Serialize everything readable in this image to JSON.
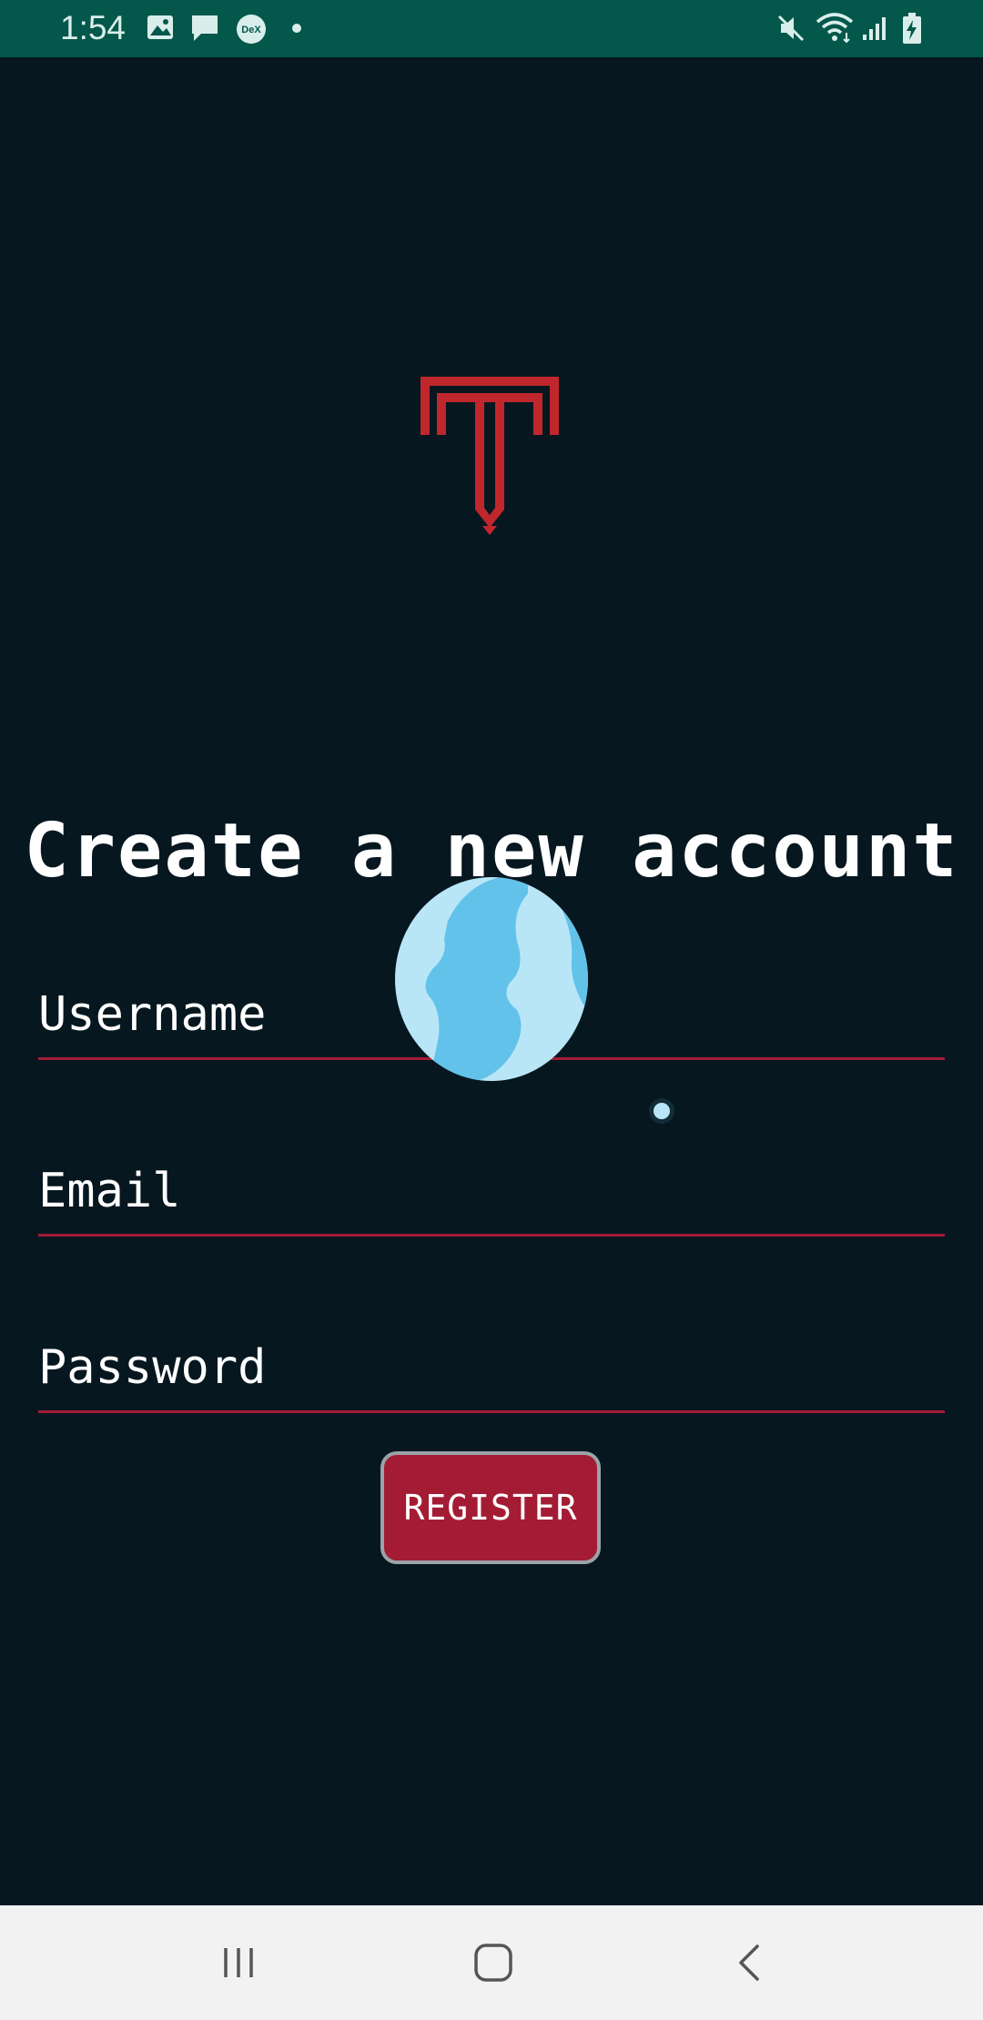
{
  "status_bar": {
    "time": "1:54",
    "left_icons": [
      "image-icon",
      "message-icon",
      "dex-icon",
      "dot-icon"
    ],
    "right_icons": [
      "mute-icon",
      "wifi-icon",
      "signal-icon",
      "battery-charging-icon"
    ],
    "dex_label": "DeX"
  },
  "logo": {
    "icon": "t-logo-icon",
    "color": "#c0272d"
  },
  "title": "Create a new account",
  "form": {
    "username_placeholder": "Username",
    "email_placeholder": "Email",
    "password_placeholder": "Password",
    "register_label": "REGISTER"
  },
  "overlay": {
    "icon": "globe-icon",
    "moon_icon": "moon-icon"
  },
  "nav_bar": {
    "recents_icon": "recents-icon",
    "home_icon": "home-icon",
    "back_icon": "back-icon"
  },
  "colors": {
    "background": "#061720",
    "status_bar": "#03574b",
    "accent": "#a31c34",
    "button_border": "#9aa3a8",
    "nav_bar": "#f2f2f2"
  }
}
